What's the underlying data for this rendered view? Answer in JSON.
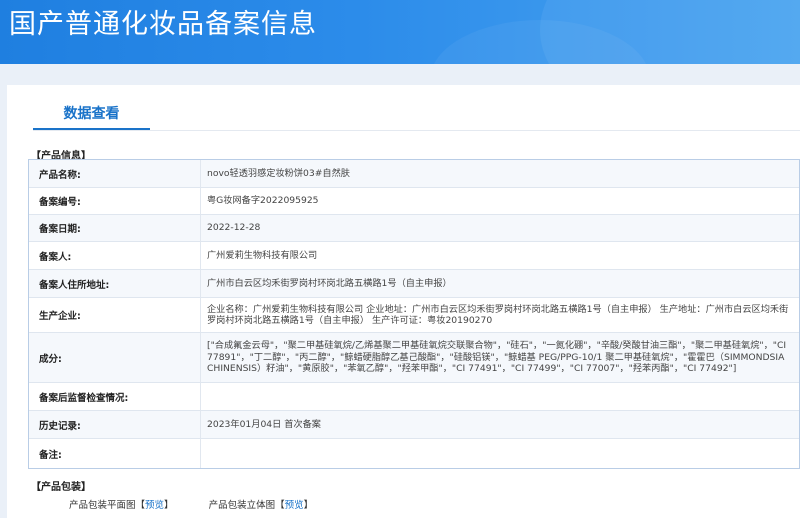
{
  "page_title": "国产普通化妆品备案信息",
  "tab": {
    "label": "数据查看"
  },
  "product_section": {
    "title": "【产品信息】"
  },
  "fields": [
    {
      "label": "产品名称:",
      "value": "novo轻透羽感定妆粉饼03#自然肤"
    },
    {
      "label": "备案编号:",
      "value": "粤G妆网备字2022095925"
    },
    {
      "label": "备案日期:",
      "value": "2022-12-28"
    },
    {
      "label": "备案人:",
      "value": "广州爱莉生物科技有限公司"
    },
    {
      "label": "备案人住所地址:",
      "value": "广州市白云区均禾街罗岗村环岗北路五横路1号（自主申报）"
    },
    {
      "label": "生产企业:",
      "value": "企业名称：广州爱莉生物科技有限公司 企业地址：广州市白云区均禾街罗岗村环岗北路五横路1号（自主申报） 生产地址：广州市白云区均禾街罗岗村环岗北路五横路1号（自主申报） 生产许可证：粤妆20190270"
    },
    {
      "label": "成分:",
      "value": "[\"合成氟金云母\"，\"聚二甲基硅氧烷/乙烯基聚二甲基硅氧烷交联聚合物\"，\"硅石\"，\"一氮化硼\"，\"辛酸/癸酸甘油三酯\"，\"聚二甲基硅氧烷\"，\"CI 77891\"，\"丁二醇\"，\"丙二醇\"，\"鲸蜡硬脂醇乙基己酸酯\"，\"硅酸铝镁\"，\"鲸蜡基 PEG/PPG-10/1 聚二甲基硅氧烷\"，\"霍霍巴（SIMMONDSIA CHINENSIS）籽油\"，\"黄原胶\"，\"苯氧乙醇\"，\"羟苯甲酯\"，\"CI 77491\"，\"CI 77499\"，\"CI 77007\"，\"羟苯丙酯\"，\"CI 77492\"]"
    },
    {
      "label": "备案后监督检查情况:",
      "value": ""
    },
    {
      "label": "历史记录:",
      "value": "2023年01月04日 首次备案"
    },
    {
      "label": "备注:",
      "value": ""
    }
  ],
  "package_section": {
    "title": "【产品包装】",
    "items": [
      {
        "label": "产品包装平面图",
        "link": "预览"
      },
      {
        "label": "产品包装立体图",
        "link": "预览"
      }
    ]
  },
  "colors": {
    "header": "#2384e3",
    "accent": "#1a73c9",
    "background": "#eaf0f8"
  }
}
